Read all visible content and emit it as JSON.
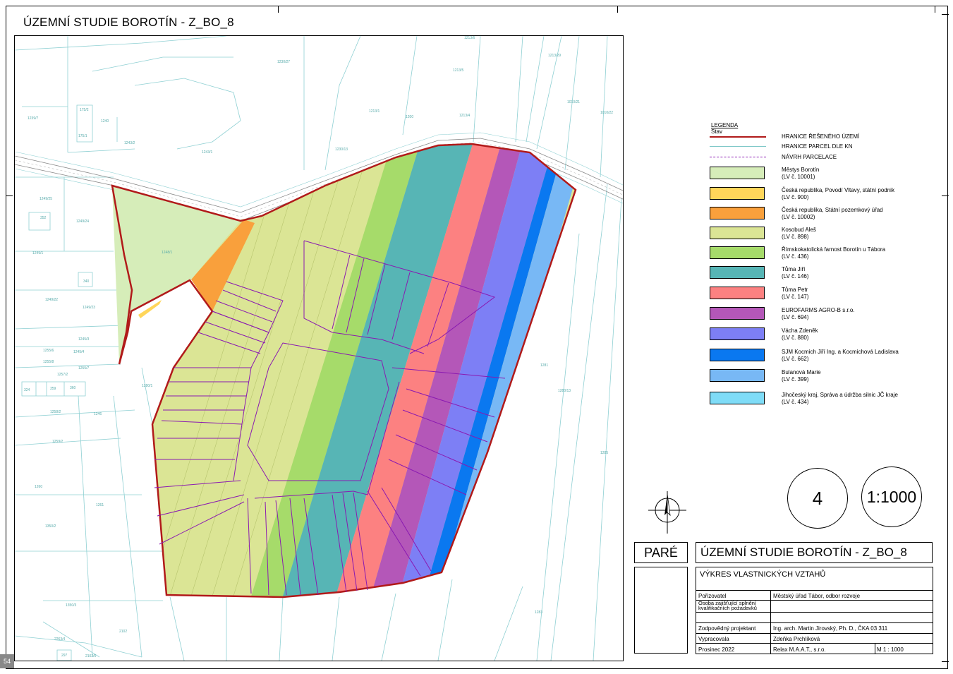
{
  "header": {
    "title": "ÚZEMNÍ STUDIE BOROTÍN - Z_BO_8"
  },
  "map": {
    "parcel_labels": [
      "1239/7",
      "175/2",
      "1240",
      "175/1",
      "1243/2",
      "1243/1",
      "1230/27",
      "1230/13",
      "1213/1",
      "1200",
      "1213/4",
      "1213/5",
      "1213/6",
      "1213/29",
      "1010/21",
      "1010/22",
      "1249/25",
      "352",
      "1249/24",
      "1249/1",
      "1248/1",
      "340",
      "1249/22",
      "1249/23",
      "1245/3",
      "1255/6",
      "1245/4",
      "1255/8",
      "1255/7",
      "1257/2",
      "324",
      "359",
      "360",
      "1258/2",
      "1280/1",
      "1246",
      "1259/2",
      "1260",
      "1261",
      "1350/2",
      "1350/3",
      "1281",
      "1280/13",
      "1285",
      "1283",
      "2102",
      "2263/4",
      "297",
      "2102/5"
    ],
    "legend_heading": "LEGENDA",
    "legend_subheading": "Stav"
  },
  "legend": {
    "lines": [
      {
        "label": "HRANICE ŘEŠENÉHO ÚZEMÍ",
        "color": "#b11a1a"
      },
      {
        "label": "HRANICE PARCEL DLE KN",
        "color": "#7fc8c8"
      },
      {
        "label": "NÁVRH PARCELACE",
        "color": "#8a1ab1"
      }
    ],
    "owners": [
      {
        "name": "Městys Borotín",
        "lv": "(LV č. 10001)",
        "color": "#d6edb9"
      },
      {
        "name": "Česká republika, Povodí Vltavy, státní podnik",
        "lv": "(LV č. 900)",
        "color": "#ffd65a"
      },
      {
        "name": "Česká republika, Státní pozemkový úřad",
        "lv": "(LV č. 10002)",
        "color": "#f9a03c"
      },
      {
        "name": "Kosobud Aleš",
        "lv": "(LV č. 898)",
        "color": "#dbe595"
      },
      {
        "name": "Římskokatolická farnost Borotín u Tábora",
        "lv": "(LV č. 436)",
        "color": "#a6db6a"
      },
      {
        "name": "Tůma Jiří",
        "lv": "(LV č. 146)",
        "color": "#57b5b5"
      },
      {
        "name": "Tůma Petr",
        "lv": "(LV č. 147)",
        "color": "#fc8181"
      },
      {
        "name": "EUROFARMS AGRO-B s.r.o.",
        "lv": "(LV č. 694)",
        "color": "#b457b8"
      },
      {
        "name": "Vácha Zdeněk",
        "lv": "(LV č. 880)",
        "color": "#7d7ff5"
      },
      {
        "name": "SJM Kocmich Jiří Ing. a Kocmichová Ladislava",
        "lv": "(LV č. 662)",
        "color": "#0a78f0"
      },
      {
        "name": "Bulanová Marie",
        "lv": "(LV č. 399)",
        "color": "#78b8f5"
      },
      {
        "name": "Jihočeský kraj, Správa a údržba silnic JČ kraje",
        "lv": "(LV č. 434)",
        "color": "#7fdcf7"
      }
    ]
  },
  "sheet": {
    "number": "4",
    "scale": "1:1000"
  },
  "title_block": {
    "pare": "PARÉ",
    "project": "ÚZEMNÍ STUDIE BOROTÍN - Z_BO_8",
    "drawing": "VÝKRES VLASTNICKÝCH VZTAHŮ",
    "rows": [
      {
        "k": "Pořizovatel",
        "v": "Městský úřad Tábor, odbor rozvoje"
      },
      {
        "k": "Osoba zajišťující splnění kvalifikačních požadavků",
        "v": ""
      },
      {
        "k": "Zodpovědný projektant",
        "v": "Ing. arch. Martin Jirovský, Ph. D., ČKA 03 311"
      },
      {
        "k": "Vypracovala",
        "v": "Zdeňka Prchlíková"
      },
      {
        "k": "Prosinec 2022",
        "v": "Relax M.A.A.T., s.r.o.",
        "extra": "M 1 : 1000"
      }
    ]
  },
  "corner_mark": "54"
}
